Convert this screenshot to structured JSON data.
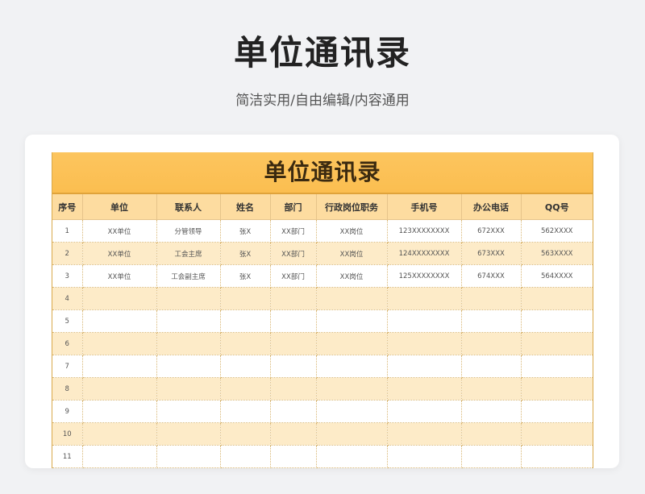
{
  "header": {
    "title": "单位通讯录",
    "subtitle": "简洁实用/自由编辑/内容通用"
  },
  "sheet": {
    "title": "单位通讯录",
    "columns": [
      "序号",
      "单位",
      "联系人",
      "姓名",
      "部门",
      "行政岗位职务",
      "手机号",
      "办公电话",
      "QQ号"
    ],
    "rows": [
      [
        "1",
        "XX单位",
        "分管领导",
        "张X",
        "XX部门",
        "XX岗位",
        "123XXXXXXXX",
        "672XXX",
        "562XXXX"
      ],
      [
        "2",
        "XX单位",
        "工会主席",
        "张X",
        "XX部门",
        "XX岗位",
        "124XXXXXXXX",
        "673XXX",
        "563XXXX"
      ],
      [
        "3",
        "XX单位",
        "工会副主席",
        "张X",
        "XX部门",
        "XX岗位",
        "125XXXXXXXX",
        "674XXX",
        "564XXXX"
      ],
      [
        "4",
        "",
        "",
        "",
        "",
        "",
        "",
        "",
        ""
      ],
      [
        "5",
        "",
        "",
        "",
        "",
        "",
        "",
        "",
        ""
      ],
      [
        "6",
        "",
        "",
        "",
        "",
        "",
        "",
        "",
        ""
      ],
      [
        "7",
        "",
        "",
        "",
        "",
        "",
        "",
        "",
        ""
      ],
      [
        "8",
        "",
        "",
        "",
        "",
        "",
        "",
        "",
        ""
      ],
      [
        "9",
        "",
        "",
        "",
        "",
        "",
        "",
        "",
        ""
      ],
      [
        "10",
        "",
        "",
        "",
        "",
        "",
        "",
        "",
        ""
      ],
      [
        "11",
        "",
        "",
        "",
        "",
        "",
        "",
        "",
        ""
      ]
    ]
  },
  "colors": {
    "title_band": "#fbbe50",
    "header_row": "#fddca0",
    "stripe_row": "#fdebc8",
    "page_background": "#f1f2f4"
  }
}
